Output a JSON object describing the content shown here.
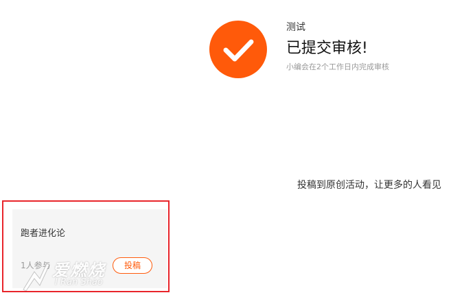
{
  "status": {
    "activity_name": "测试",
    "title": "已提交审核!",
    "subtitle": "小编会在2个工作日内完成审核",
    "icon": "checkmark-icon",
    "accent_color": "#ff5a0a"
  },
  "promo": {
    "text": "投稿到原创活动，让更多的人看见"
  },
  "activity_card": {
    "title": "跑者进化论",
    "participants": "1人参与",
    "submit_label": "投稿",
    "highlight_color": "#e8242a"
  },
  "watermark": {
    "brand_cn": "爱燃烧",
    "brand_en": "I Ran Shao"
  }
}
